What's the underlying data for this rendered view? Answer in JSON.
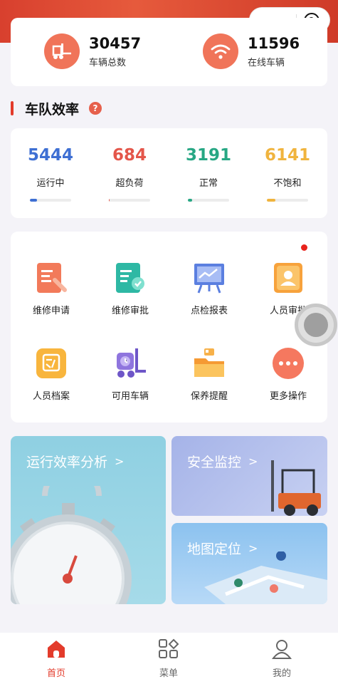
{
  "header": {
    "capsule_more_icon": "more-dots-icon",
    "capsule_close_icon": "record-close-icon"
  },
  "stats": [
    {
      "value": "30457",
      "label": "车辆总数",
      "icon": "forklift-icon"
    },
    {
      "value": "11596",
      "label": "在线车辆",
      "icon": "wifi-icon"
    }
  ],
  "efficiency": {
    "title": "车队效率",
    "help_icon": "question-icon",
    "items": [
      {
        "value": "5444",
        "label": "运行中",
        "color": "#3e6fd3",
        "progress": 0.18
      },
      {
        "value": "684",
        "label": "超负荷",
        "color": "#e4564a",
        "progress": 0.02
      },
      {
        "value": "3191",
        "label": "正常",
        "color": "#27a784",
        "progress": 0.1
      },
      {
        "value": "6141",
        "label": "不饱和",
        "color": "#f0b43e",
        "progress": 0.2
      }
    ]
  },
  "functions": [
    {
      "label": "维修申请",
      "icon": "repair-request-icon"
    },
    {
      "label": "维修审批",
      "icon": "repair-approval-icon"
    },
    {
      "label": "点检报表",
      "icon": "inspection-report-icon"
    },
    {
      "label": "人员审批",
      "icon": "staff-approval-icon"
    },
    {
      "label": "人员档案",
      "icon": "staff-archive-icon"
    },
    {
      "label": "可用车辆",
      "icon": "available-vehicle-icon"
    },
    {
      "label": "保养提醒",
      "icon": "maintenance-reminder-icon"
    },
    {
      "label": "更多操作",
      "icon": "more-actions-icon"
    }
  ],
  "tiles": {
    "efficiency_analysis": "运行效率分析",
    "safety_monitor": "安全监控",
    "map_location": "地图定位",
    "chevron": ">"
  },
  "tabbar": [
    {
      "label": "首页",
      "icon": "home-icon",
      "active": true,
      "color": "#e33b2b"
    },
    {
      "label": "菜单",
      "icon": "grid-menu-icon",
      "active": false,
      "color": "#666666"
    },
    {
      "label": "我的",
      "icon": "user-icon",
      "active": false,
      "color": "#666666"
    }
  ]
}
